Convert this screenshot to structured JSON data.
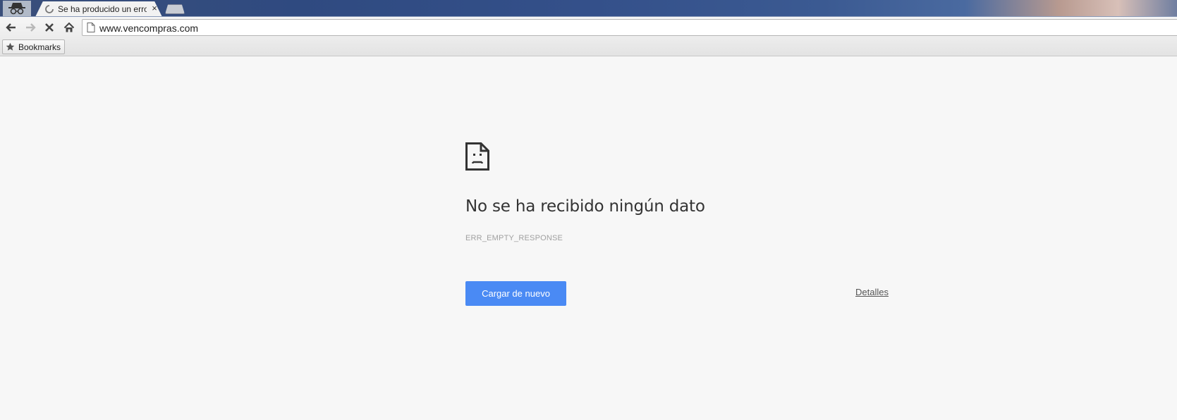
{
  "browser": {
    "tab": {
      "title": "Se ha producido un error",
      "close_glyph": "×"
    },
    "toolbar": {
      "back_icon": "back-arrow-icon",
      "forward_icon": "forward-arrow-icon",
      "stop_icon": "stop-icon",
      "home_icon": "home-icon"
    },
    "omnibox": {
      "url": "www.vencompras.com"
    },
    "bookmarks": {
      "label": "Bookmarks"
    }
  },
  "error_page": {
    "heading": "No se ha recibido ningún dato",
    "code": "ERR_EMPTY_RESPONSE",
    "reload_label": "Cargar de nuevo",
    "details_label": "Detalles"
  },
  "colors": {
    "reload_button": "#4a8af4",
    "page_background": "#f7f7f7"
  }
}
